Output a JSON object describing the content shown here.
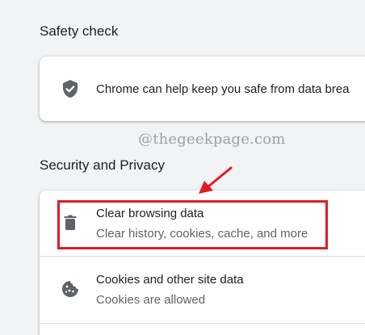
{
  "safety_check": {
    "heading": "Safety check",
    "description": "Chrome can help keep you safe from data brea"
  },
  "watermark": "@thegeekpage.com",
  "security_privacy": {
    "heading": "Security and Privacy",
    "items": [
      {
        "title": "Clear browsing data",
        "subtitle": "Clear history, cookies, cache, and more",
        "icon": "trash-icon"
      },
      {
        "title": "Cookies and other site data",
        "subtitle": "Cookies are allowed",
        "icon": "cookie-icon"
      }
    ]
  },
  "annotation": {
    "highlight_color": "#e01b24"
  }
}
